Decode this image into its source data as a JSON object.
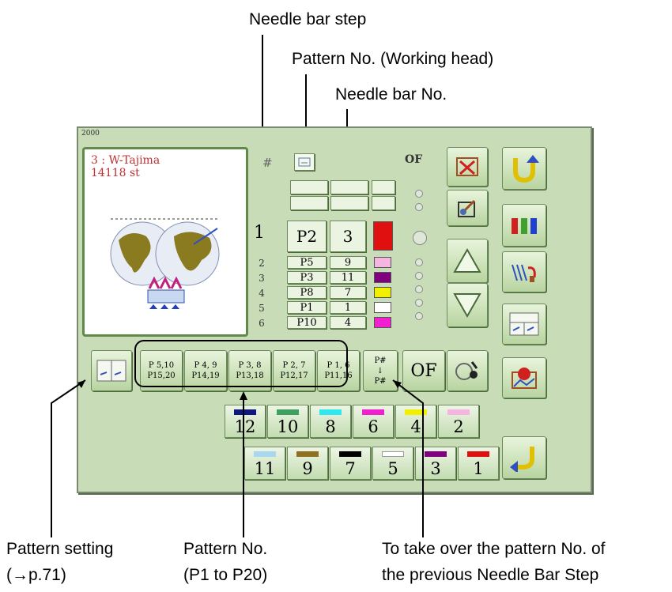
{
  "callouts": {
    "needle_bar_step": "Needle bar step",
    "pattern_working_head": "Pattern No. (Working head)",
    "needle_bar_no": "Needle bar No.",
    "pattern_setting_l1": "Pattern setting",
    "pattern_setting_l2": "(→p.71)",
    "pattern_no_l1": "Pattern No.",
    "pattern_no_l2": "(P1 to P20)",
    "take_over_l1": "To take over the pattern No. of",
    "take_over_l2": "the previous Needle Bar Step"
  },
  "panel": {
    "number": "2000",
    "design_name": "3 : W-Tajima",
    "stitch_count": "14118 st",
    "header_symbol": "#",
    "of_label": "OF",
    "of_button": "OF"
  },
  "current_step": {
    "step": "1",
    "pattern": "P2",
    "needle": "3",
    "color": "#e01010"
  },
  "steps": [
    {
      "step": "2",
      "pattern": "P5",
      "needle": "9",
      "color": "#f4b6e0"
    },
    {
      "step": "3",
      "pattern": "P3",
      "needle": "11",
      "color": "#800080"
    },
    {
      "step": "4",
      "pattern": "P8",
      "needle": "7",
      "color": "#f0f000"
    },
    {
      "step": "5",
      "pattern": "P1",
      "needle": "1",
      "color": "#ffffff"
    },
    {
      "step": "6",
      "pattern": "P10",
      "needle": "4",
      "color": "#f020d0"
    }
  ],
  "pattern_buttons": [
    {
      "top": "P 5,10",
      "bottom": "P15,20"
    },
    {
      "top": "P 4, 9",
      "bottom": "P14,19"
    },
    {
      "top": "P 3, 8",
      "bottom": "P13,18"
    },
    {
      "top": "P 2, 7",
      "bottom": "P12,17"
    },
    {
      "top": "P 1, 6",
      "bottom": "P11,16"
    }
  ],
  "take_over_button": {
    "top": "P#",
    "mid": "↓",
    "bottom": "P#"
  },
  "needle_row_top": [
    {
      "num": "12",
      "color": "#101880"
    },
    {
      "num": "10",
      "color": "#3fa060"
    },
    {
      "num": "8",
      "color": "#30e8f0"
    },
    {
      "num": "6",
      "color": "#f020d0"
    },
    {
      "num": "4",
      "color": "#f0f000"
    },
    {
      "num": "2",
      "color": "#f4b6e0"
    }
  ],
  "needle_row_bottom": [
    {
      "num": "11",
      "color": "#a8d8f0"
    },
    {
      "num": "9",
      "color": "#907020"
    },
    {
      "num": "7",
      "color": "#000000"
    },
    {
      "num": "5",
      "color": "#ffffff"
    },
    {
      "num": "3",
      "color": "#800080"
    },
    {
      "num": "1",
      "color": "#e01010"
    }
  ]
}
